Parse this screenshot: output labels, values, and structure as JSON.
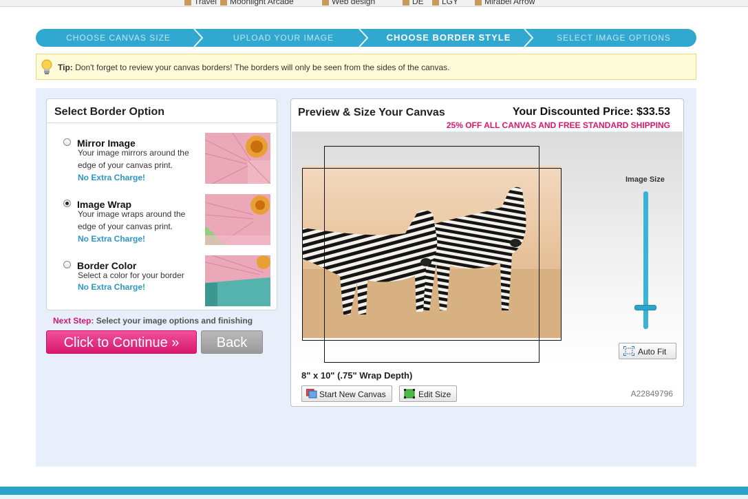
{
  "bookmarks": [
    "Travel",
    "Moonlight Arcade",
    "Web design",
    "DE",
    "LGY",
    "Mirabel Arrow"
  ],
  "steps": [
    {
      "label": "CHOOSE CANVAS SIZE",
      "active": false
    },
    {
      "label": "UPLOAD YOUR IMAGE",
      "active": false
    },
    {
      "label": "CHOOSE BORDER STYLE",
      "active": true
    },
    {
      "label": "SELECT IMAGE OPTIONS",
      "active": false
    }
  ],
  "tip": {
    "label": "Tip:",
    "text": "Don't forget to review your canvas borders! The borders will only be seen from the sides of the canvas."
  },
  "border_panel": {
    "title": "Select Border Option",
    "options": [
      {
        "title": "Mirror Image",
        "line1": "Your image mirrors around the",
        "line2": "edge of your canvas print.",
        "charge": "No Extra Charge!",
        "selected": false
      },
      {
        "title": "Image Wrap",
        "line1": "Your image wraps around the",
        "line2": "edge of your canvas print.",
        "charge": "No Extra Charge!",
        "selected": true
      },
      {
        "title": "Border Color",
        "line1": "Select a color for your border",
        "line2": "",
        "charge": "No Extra Charge!",
        "selected": false
      }
    ]
  },
  "next_step": {
    "label": "Next Step:",
    "text": "Select your image options and finishing"
  },
  "buttons": {
    "continue": "Click to Continue »",
    "back": "Back"
  },
  "preview": {
    "title": "Preview & Size Your Canvas",
    "price": "Your Discounted Price: $33.53",
    "promo": "25% OFF ALL CANVAS AND FREE STANDARD SHIPPING",
    "image_size_label": "Image Size",
    "image_size_level": 0.17,
    "autofit": "Auto Fit",
    "dimensions": "8\" x 10\" (.75\" Wrap Depth)",
    "start_new": "Start New Canvas",
    "edit_size": "Edit Size",
    "code": "A22849796"
  },
  "colors": {
    "accent": "#31a8cf",
    "pink": "#d8186e",
    "link": "#2d97c3"
  }
}
